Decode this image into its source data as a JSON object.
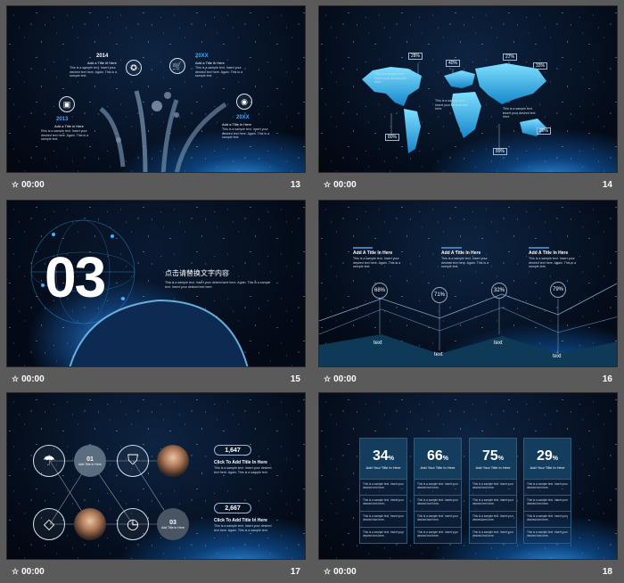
{
  "slides": [
    {
      "number": "13",
      "time": "00:00",
      "items": [
        {
          "year": "2014",
          "title": "Add a Title in Here",
          "body": "This is a sample text. Insert your desired text here. Again. This is a sample text."
        },
        {
          "year": "20XX",
          "title": "Add a Title in Here",
          "body": "This is a sample text. Insert your desired text here. Again. This is a sample text."
        },
        {
          "year": "2013",
          "title": "Add a Title in Here",
          "body": "This is a sample text. Insert your desired text here. Again. This is a sample text."
        },
        {
          "year": "20XX",
          "title": "Add a Title in Here",
          "body": "This is a sample text. Insert your desired text here. Again. This is a sample text."
        }
      ]
    },
    {
      "number": "14",
      "time": "00:00",
      "map_labels": [
        "28%",
        "40%",
        "27%",
        "33%",
        "80%",
        "89%",
        "20%"
      ],
      "body": "This is a sample text. Insert your desired text here."
    },
    {
      "number": "15",
      "time": "00:00",
      "big_number": "03",
      "heading": "点击请替换文字内容",
      "body": "This is a sample text. Insert your desired text here. Again. This is a sample text. Insert your desired text here."
    },
    {
      "number": "16",
      "time": "00:00",
      "columns": [
        {
          "title": "Add A Title In Here",
          "body": "This is a sample text. Insert your desired text here. Again. This is a sample text."
        },
        {
          "title": "Add A Title In Here",
          "body": "This is a sample text. Insert your desired text here. Again. This is a sample text."
        },
        {
          "title": "Add A Title In Here",
          "body": "This is a sample text. Insert your desired text here. Again. This is a sample text."
        }
      ],
      "percents": [
        "68%",
        "71%",
        "32%",
        "79%"
      ],
      "labels": [
        "text",
        "text",
        "text",
        "text"
      ]
    },
    {
      "number": "17",
      "time": "00:00",
      "node1": "01",
      "node1_sub": "Add Title in Here",
      "node2": "03",
      "node2_sub": "Add Title in Here",
      "stat1": "1,647",
      "stat1_title": "Click To Add Title In Here",
      "stat2": "2,667",
      "stat2_title": "Click To Add Title In Here",
      "body": "This is a sample text. Insert your desired text here. Again. This is a sample text."
    },
    {
      "number": "18",
      "time": "00:00",
      "cards": [
        {
          "value": "34",
          "unit": "%",
          "title": "Add Your Title In Here"
        },
        {
          "value": "66",
          "unit": "%",
          "title": "Add Your Title In Here"
        },
        {
          "value": "75",
          "unit": "%",
          "title": "Add Your Title In Here"
        },
        {
          "value": "29",
          "unit": "%",
          "title": "Add Your Title In Here"
        }
      ],
      "row_text": "This is a sample text. Insert your desired text here."
    }
  ]
}
